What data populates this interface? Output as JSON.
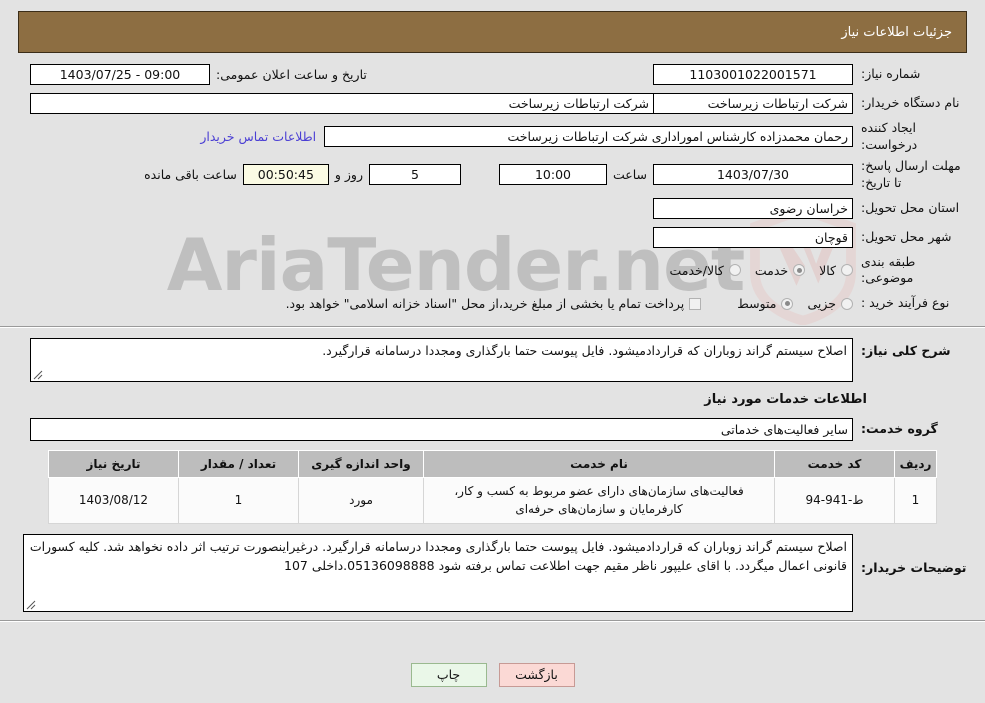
{
  "header": {
    "title": "جزئیات اطلاعات نیاز"
  },
  "form": {
    "need_number_label": "شماره نیاز:",
    "need_number_value": "1103001022001571",
    "announce_label": "تاریخ و ساعت اعلان عمومی:",
    "announce_value": "09:00 - 1403/07/25",
    "buyer_org_label": "نام دستگاه خریدار:",
    "buyer_org_value": "شرکت ارتباطات زیرساخت",
    "buyer_org_value2": "شرکت ارتباطات زیرساخت",
    "creator_label": "ایجاد کننده درخواست:",
    "creator_value": "رحمان محمدزاده کارشناس اموراداری  شرکت ارتباطات زیرساخت",
    "contact_link": "اطلاعات تماس خریدار",
    "deadline_label": "مهلت ارسال پاسخ: تا تاریخ:",
    "deadline_date": "1403/07/30",
    "hour_label": "ساعت",
    "deadline_time": "10:00",
    "days_left": "5",
    "days_label": "روز و",
    "countdown": "00:50:45",
    "remaining_label": "ساعت باقی مانده",
    "province_label": "استان محل تحویل:",
    "province_value": "خراسان رضوی",
    "city_label": "شهر محل تحویل:",
    "city_value": "قوچان",
    "category_label": "طبقه بندی موضوعی:",
    "category_options": [
      {
        "label": "کالا",
        "selected": false
      },
      {
        "label": "خدمت",
        "selected": true
      },
      {
        "label": "کالا/خدمت",
        "selected": false
      }
    ],
    "process_label": "نوع فرآیند خرید :",
    "process_options": [
      {
        "label": "جزیی",
        "selected": false
      },
      {
        "label": "متوسط",
        "selected": true
      }
    ],
    "treasury_checkbox_label": "پرداخت تمام یا بخشی از مبلغ خرید،از محل \"اسناد خزانه اسلامی\" خواهد بود.",
    "treasury_checked": false
  },
  "description": {
    "label": "شرح کلی نیاز:",
    "text": "اصلاح سیستم گراند زوباران که قراردادمیشود. فایل پیوست حتما بارگذاری ومجددا درسامانه  قرارگیرد."
  },
  "services_section": {
    "heading": "اطلاعات خدمات مورد نیاز",
    "group_label": "گروه خدمت:",
    "group_value": "سایر فعالیت‌های خدماتی"
  },
  "table": {
    "headers": [
      "ردیف",
      "کد خدمت",
      "نام خدمت",
      "واحد اندازه گیری",
      "تعداد / مقدار",
      "تاریخ نیاز"
    ],
    "rows": [
      {
        "row": "1",
        "code": "ط-941-94",
        "name": "فعالیت‌های سازمان‌های دارای عضو مربوط به کسب و کار، کارفرمایان و سازمان‌های حرفه‌ای",
        "unit": "مورد",
        "qty": "1",
        "date": "1403/08/12"
      }
    ]
  },
  "buyer_notes": {
    "label": "توضیحات خریدار:",
    "text": "اصلاح سیستم گراند زوباران که قراردادمیشود. فایل پیوست حتما بارگذاری ومجددا درسامانه  قرارگیرد. درغیراینصورت ترتیب اثر داده نخواهد شد. کلیه کسورات قانونی اعمال میگردد. با اقای علیپور ناظر مقیم جهت اطلاعت تماس برفته شود 05136098888.داخلی 107"
  },
  "buttons": {
    "print": "چاپ",
    "back": "بازگشت"
  },
  "watermark": {
    "text": "AriaTender.net"
  },
  "colors": {
    "header_bg": "#8d6e42",
    "table_header_bg": "#bdbdbd",
    "link": "#4b3fd4",
    "countdown_bg": "#fbfbe4",
    "print_btn": "#eaf7e8",
    "back_btn": "#fbd9d5"
  }
}
